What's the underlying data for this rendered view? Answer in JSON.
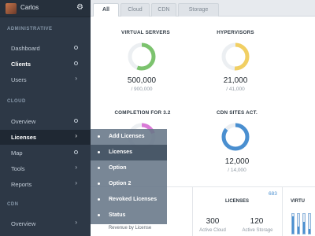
{
  "user": {
    "name": "Carlos",
    "avatar_icon": "user-avatar",
    "settings_icon": "gear-icon"
  },
  "sidebar": {
    "sections": [
      {
        "label": "ADMINISTRATIVE"
      },
      {
        "label": "CLOUD"
      },
      {
        "label": "CDN"
      }
    ],
    "items": [
      {
        "label": "Dashboard",
        "indicator": "ring"
      },
      {
        "label": "Clients",
        "indicator": "ring"
      },
      {
        "label": "Users",
        "indicator": "chevron"
      },
      {
        "label": "Overview",
        "indicator": "ring"
      },
      {
        "label": "Licenses",
        "indicator": "chevron"
      },
      {
        "label": "Map",
        "indicator": "ring"
      },
      {
        "label": "Tools",
        "indicator": "chevron"
      },
      {
        "label": "Reports",
        "indicator": "chevron"
      },
      {
        "label": "Overview",
        "indicator": "chevron"
      }
    ]
  },
  "tabs": [
    {
      "label": "All"
    },
    {
      "label": "Cloud"
    },
    {
      "label": "CDN"
    },
    {
      "label": "Storage"
    }
  ],
  "stats": [
    {
      "title": "VIRTUAL SERVERS",
      "value": "500,000",
      "sub": "/ 900,000",
      "fraction": 0.56,
      "color": "#7cc36e"
    },
    {
      "title": "HYPERVISORS",
      "value": "21,000",
      "sub": "/ 41,000",
      "fraction": 0.51,
      "color": "#f1cf63"
    },
    {
      "title": "COMPLETION FOR 3.2",
      "fraction": 0.2,
      "color": "#d97ad7"
    },
    {
      "title": "CDN SITES ACT.",
      "value": "12,000",
      "sub": "/ 14,000",
      "fraction": 0.86,
      "color": "#4a8fd0"
    }
  ],
  "bottom": {
    "revenue_label": "Revenue by License",
    "licenses_title": "LICENSES",
    "licenses_link": "683",
    "active_cloud_value": "300",
    "active_cloud_label": "Active Cloud",
    "active_storage_value": "120",
    "active_storage_label": "Active Storage",
    "virt_title": "VIRTU",
    "mini_bars": [
      0.9,
      0.35,
      0.6,
      0.25
    ]
  },
  "submenu": {
    "items": [
      {
        "label": "Add Licenses"
      },
      {
        "label": "Licenses"
      },
      {
        "label": "Option"
      },
      {
        "label": "Option 2"
      },
      {
        "label": "Revoked Licenses"
      },
      {
        "label": "Status"
      }
    ]
  }
}
